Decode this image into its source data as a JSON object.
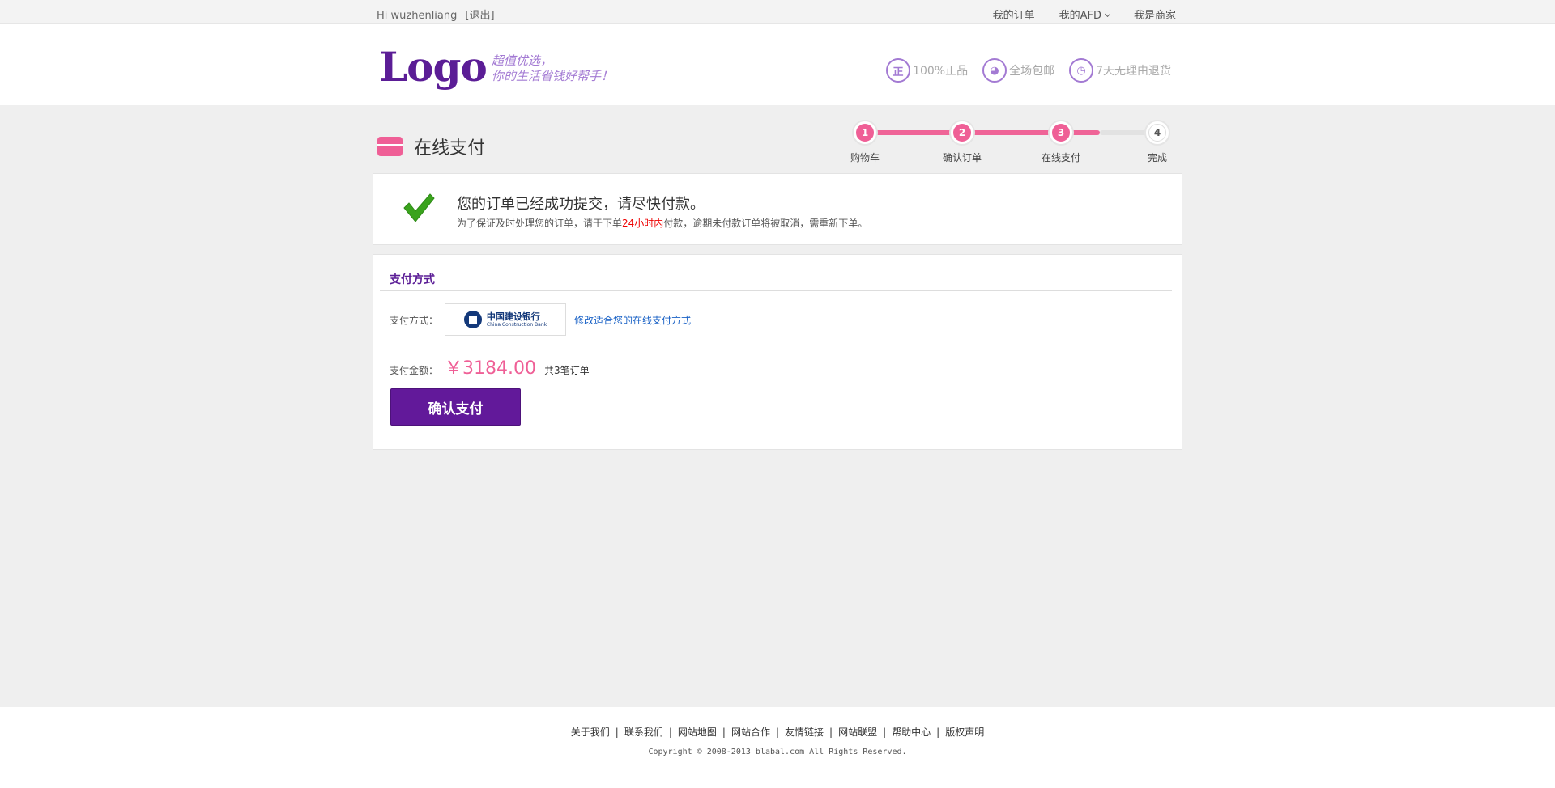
{
  "topbar": {
    "greeting": "Hi wuzhenliang",
    "logout": "[退出]",
    "my_orders": "我的订单",
    "my_afd": "我的AFD",
    "merchant": "我是商家"
  },
  "header": {
    "logo": "Logo",
    "slogan_line1": "超值优选，",
    "slogan_line2": "你的生活省钱好帮手！",
    "features": [
      {
        "icon": "正",
        "label": "100%正品"
      },
      {
        "icon": "◕",
        "label": "全场包邮"
      },
      {
        "icon": "◷",
        "label": "7天无理由退货"
      }
    ]
  },
  "page": {
    "title": "在线支付"
  },
  "steps": [
    {
      "num": "1",
      "label": "购物车",
      "done": true
    },
    {
      "num": "2",
      "label": "确认订单",
      "done": true
    },
    {
      "num": "3",
      "label": "在线支付",
      "done": true
    },
    {
      "num": "4",
      "label": "完成",
      "done": false
    }
  ],
  "success": {
    "headline": "您的订单已经成功提交，请尽快付款。",
    "note_before": "为了保证及时处理您的订单，请于下单",
    "note_highlight": "24小时内",
    "note_after": "付款，逾期未付款订单将被取消，需重新下单。"
  },
  "payment": {
    "section_title": "支付方式",
    "method_label": "支付方式：",
    "bank_cn": "中国建设银行",
    "bank_en": "China Construction Bank",
    "change_link": "修改适合您的在线支付方式",
    "amount_label": "支付金额：",
    "amount": "￥3184.00",
    "order_count": "共3笔订单",
    "confirm_button": "确认支付"
  },
  "footer": {
    "links": [
      "关于我们",
      "联系我们",
      "网站地图",
      "网站合作",
      "友情链接",
      "网站联盟",
      "帮助中心",
      "版权声明"
    ],
    "copyright": "Copyright © 2008-2013 blabal.com All Rights Reserved."
  },
  "colors": {
    "brand_purple": "#5b1d96",
    "accent_pink": "#ef5f96",
    "link_blue": "#1a62c6",
    "highlight_red": "#ee0000"
  }
}
